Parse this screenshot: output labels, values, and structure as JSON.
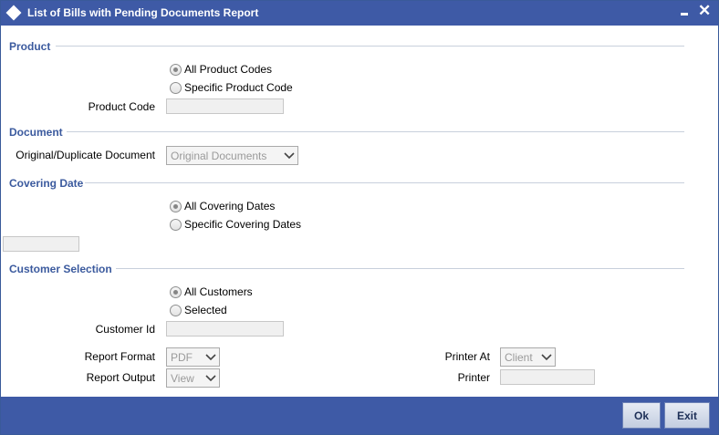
{
  "window": {
    "title": "List of Bills with Pending Documents Report"
  },
  "sections": {
    "product": {
      "title": "Product",
      "options": [
        "All Product Codes",
        "Specific Product Code"
      ],
      "selected": "All Product Codes",
      "product_code_label": "Product Code",
      "product_code_value": ""
    },
    "document": {
      "title": "Document",
      "label": "Original/Duplicate Document",
      "value": "Original Documents"
    },
    "covering_date": {
      "title": "Covering Date",
      "options": [
        "All Covering Dates",
        "Specific Covering Dates"
      ],
      "selected": "All Covering Dates",
      "date_value": ""
    },
    "customer_selection": {
      "title": "Customer Selection",
      "options": [
        "All Customers",
        "Selected"
      ],
      "selected": "All Customers",
      "customer_id_label": "Customer Id",
      "customer_id_value": ""
    }
  },
  "report": {
    "format_label": "Report Format",
    "format_value": "PDF",
    "output_label": "Report Output",
    "output_value": "View",
    "printer_at_label": "Printer At",
    "printer_at_value": "Client",
    "printer_label": "Printer",
    "printer_value": ""
  },
  "buttons": {
    "ok": "Ok",
    "exit": "Exit"
  },
  "icons": {
    "title": "diamond-icon",
    "minimize": "minimize-icon",
    "close": "close-icon",
    "dropdown": "chevron-down-icon"
  },
  "colors": {
    "titlebar": "#3e5aa6",
    "section_title": "#3b5a9e"
  }
}
